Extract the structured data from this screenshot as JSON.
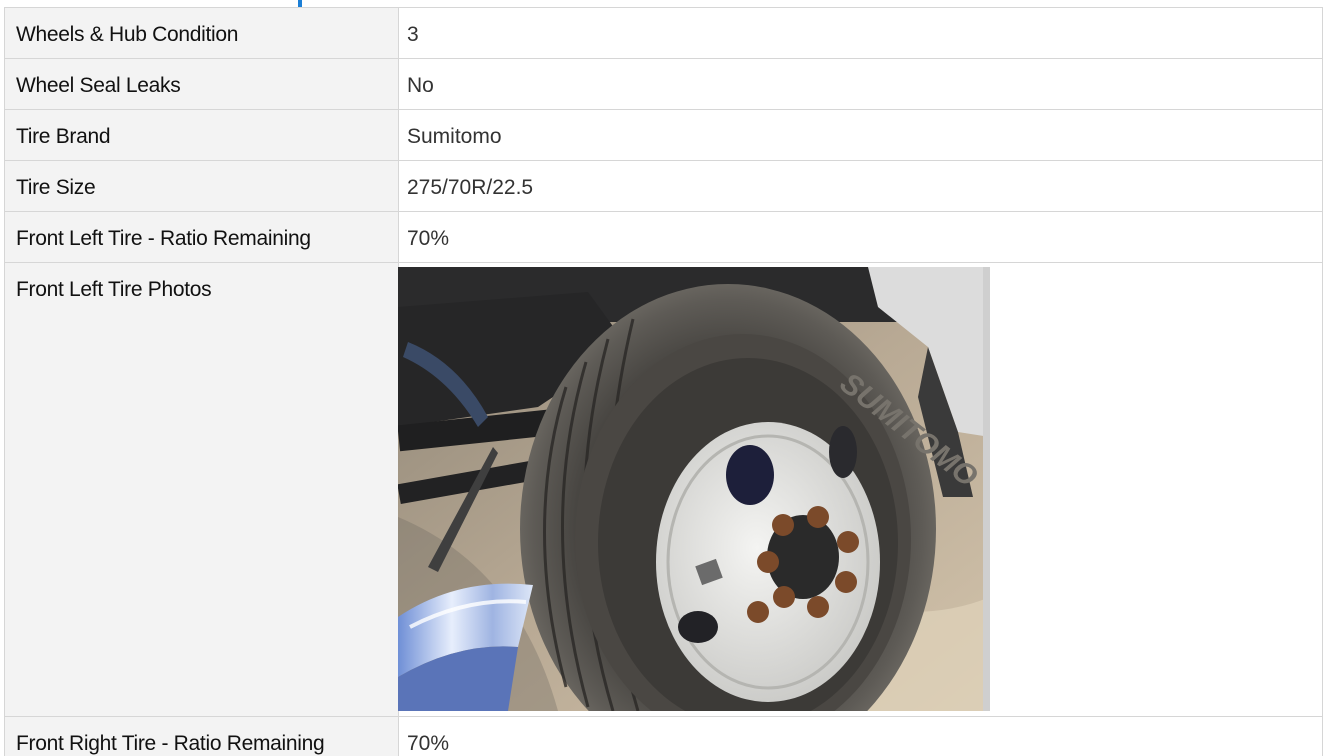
{
  "rows": [
    {
      "label": "Wheels & Hub Condition",
      "value": "3"
    },
    {
      "label": "Wheel Seal Leaks",
      "value": "No"
    },
    {
      "label": "Tire Brand",
      "value": "Sumitomo"
    },
    {
      "label": "Tire Size",
      "value": "275/70R/22.5"
    },
    {
      "label": "Front Left Tire - Ratio Remaining",
      "value": "70%"
    },
    {
      "label": "Front Left Tire Photos"
    },
    {
      "label": "Front Right Tire - Ratio Remaining",
      "value": "70%"
    }
  ],
  "photo": {
    "sidewall_text": "SUMITOMO"
  },
  "colors": {
    "accent": "#1c7fd6",
    "label_bg": "#f3f3f3",
    "border": "#d6d6d6"
  }
}
